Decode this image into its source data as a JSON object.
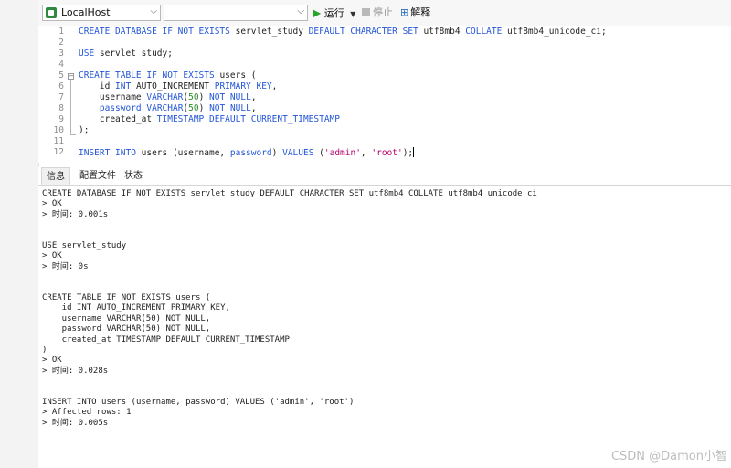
{
  "toolbar": {
    "connection": "LocalHost",
    "database": "",
    "run_label": "运行",
    "stop_label": "停止",
    "explain_label": "解释"
  },
  "editor": {
    "lines": [
      {
        "n": "1",
        "tokens": [
          {
            "t": "CREATE DATABASE IF NOT EXISTS ",
            "c": "kw"
          },
          {
            "t": "servlet_study ",
            "c": "plain"
          },
          {
            "t": "DEFAULT CHARACTER SET ",
            "c": "kw"
          },
          {
            "t": "utf8mb4 ",
            "c": "plain"
          },
          {
            "t": "COLLATE ",
            "c": "kw"
          },
          {
            "t": "utf8mb4_unicode_ci;",
            "c": "plain"
          }
        ]
      },
      {
        "n": "2",
        "tokens": []
      },
      {
        "n": "3",
        "tokens": [
          {
            "t": "USE ",
            "c": "kw"
          },
          {
            "t": "servlet_study;",
            "c": "plain"
          }
        ]
      },
      {
        "n": "4",
        "tokens": []
      },
      {
        "n": "5",
        "tokens": [
          {
            "t": "CREATE TABLE IF NOT EXISTS ",
            "c": "kw"
          },
          {
            "t": "users (",
            "c": "plain"
          }
        ]
      },
      {
        "n": "6",
        "tokens": [
          {
            "t": "    id ",
            "c": "plain"
          },
          {
            "t": "INT ",
            "c": "kw"
          },
          {
            "t": "AUTO_INCREMENT ",
            "c": "plain"
          },
          {
            "t": "PRIMARY KEY",
            "c": "kw"
          },
          {
            "t": ",",
            "c": "plain"
          }
        ]
      },
      {
        "n": "7",
        "tokens": [
          {
            "t": "    username ",
            "c": "plain"
          },
          {
            "t": "VARCHAR",
            "c": "kw"
          },
          {
            "t": "(",
            "c": "plain"
          },
          {
            "t": "50",
            "c": "num"
          },
          {
            "t": ") ",
            "c": "plain"
          },
          {
            "t": "NOT NULL",
            "c": "kw"
          },
          {
            "t": ",",
            "c": "plain"
          }
        ]
      },
      {
        "n": "8",
        "tokens": [
          {
            "t": "    ",
            "c": "plain"
          },
          {
            "t": "password ",
            "c": "kw"
          },
          {
            "t": "VARCHAR",
            "c": "kw"
          },
          {
            "t": "(",
            "c": "plain"
          },
          {
            "t": "50",
            "c": "num"
          },
          {
            "t": ") ",
            "c": "plain"
          },
          {
            "t": "NOT NULL",
            "c": "kw"
          },
          {
            "t": ",",
            "c": "plain"
          }
        ]
      },
      {
        "n": "9",
        "tokens": [
          {
            "t": "    created_at ",
            "c": "plain"
          },
          {
            "t": "TIMESTAMP DEFAULT CURRENT_TIMESTAMP",
            "c": "kw"
          }
        ]
      },
      {
        "n": "10",
        "tokens": [
          {
            "t": ");",
            "c": "plain"
          }
        ]
      },
      {
        "n": "11",
        "tokens": []
      },
      {
        "n": "12",
        "tokens": [
          {
            "t": "INSERT INTO ",
            "c": "kw"
          },
          {
            "t": "users (username, ",
            "c": "plain"
          },
          {
            "t": "password",
            "c": "kw"
          },
          {
            "t": ") ",
            "c": "plain"
          },
          {
            "t": "VALUES ",
            "c": "kw"
          },
          {
            "t": "(",
            "c": "plain"
          },
          {
            "t": "'admin'",
            "c": "str"
          },
          {
            "t": ", ",
            "c": "plain"
          },
          {
            "t": "'root'",
            "c": "str"
          },
          {
            "t": ");",
            "c": "plain"
          }
        ],
        "caret": true
      }
    ]
  },
  "tabs": [
    "信息",
    "配置文件",
    "状态"
  ],
  "output": {
    "lines": [
      "CREATE DATABASE IF NOT EXISTS servlet_study DEFAULT CHARACTER SET utf8mb4 COLLATE utf8mb4_unicode_ci",
      "> OK",
      "> 时间: 0.001s",
      "",
      "",
      "USE servlet_study",
      "> OK",
      "> 时间: 0s",
      "",
      "",
      "CREATE TABLE IF NOT EXISTS users (",
      "    id INT AUTO_INCREMENT PRIMARY KEY,",
      "    username VARCHAR(50) NOT NULL,",
      "    password VARCHAR(50) NOT NULL,",
      "    created_at TIMESTAMP DEFAULT CURRENT_TIMESTAMP",
      ")",
      "> OK",
      "> 时间: 0.028s",
      "",
      "",
      "INSERT INTO users (username, password) VALUES ('admin', 'root')",
      "> Affected rows: 1",
      "> 时间: 0.005s"
    ]
  },
  "watermark": "CSDN @Damon小智"
}
